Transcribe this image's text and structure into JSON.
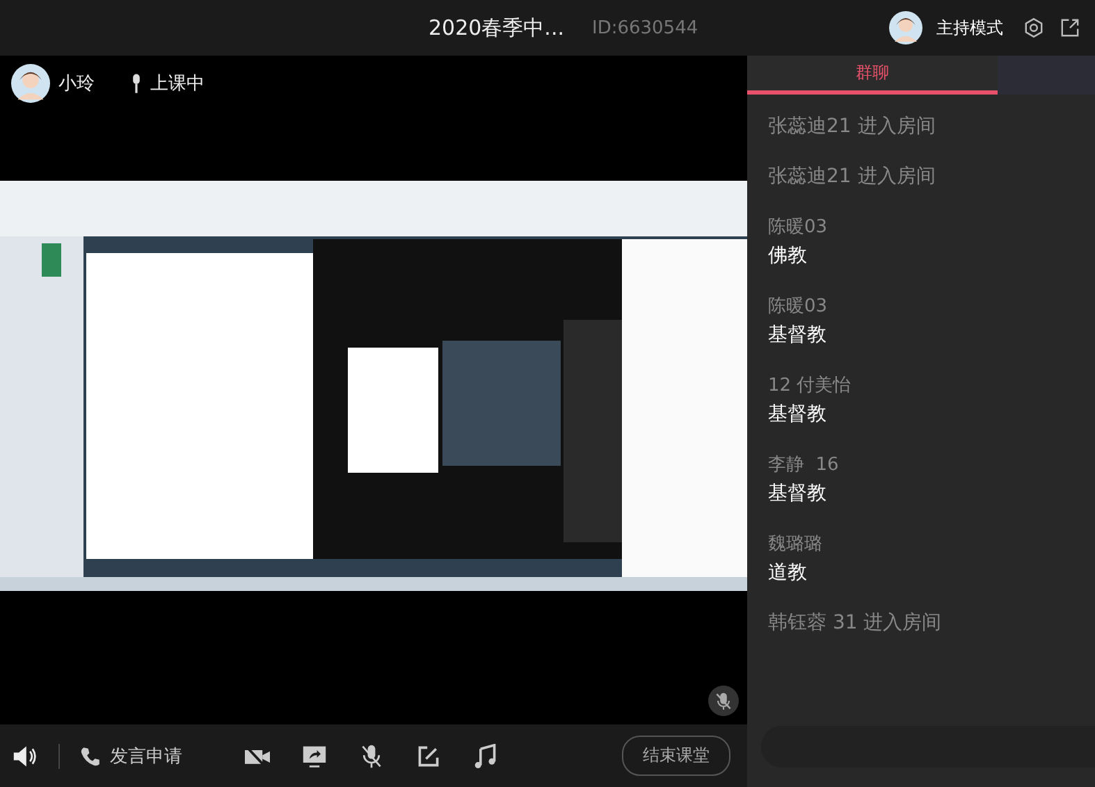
{
  "header": {
    "title": "2020春季中...",
    "room_id": "ID:6630544",
    "mode": "主持模式"
  },
  "presenter": {
    "name": "小玲",
    "status": "上课中"
  },
  "toolbar": {
    "apply_label": "发言申请",
    "end_button": "结束课堂"
  },
  "chat": {
    "tabs": [
      {
        "label": "群聊",
        "selected": true
      }
    ],
    "messages": [
      {
        "kind": "system",
        "text": "张蕊迪21 进入房间"
      },
      {
        "kind": "system",
        "text": "张蕊迪21 进入房间"
      },
      {
        "kind": "message",
        "sender": "陈暖03",
        "text": "佛教"
      },
      {
        "kind": "message",
        "sender": "陈暖03",
        "text": "基督教"
      },
      {
        "kind": "message",
        "sender": "12 付美怡",
        "text": "基督教"
      },
      {
        "kind": "message",
        "sender": "李静  16",
        "text": "基督教"
      },
      {
        "kind": "message",
        "sender": "魏璐璐",
        "text": "道教"
      },
      {
        "kind": "system",
        "text": "韩钰蓉 31 进入房间"
      }
    ]
  }
}
